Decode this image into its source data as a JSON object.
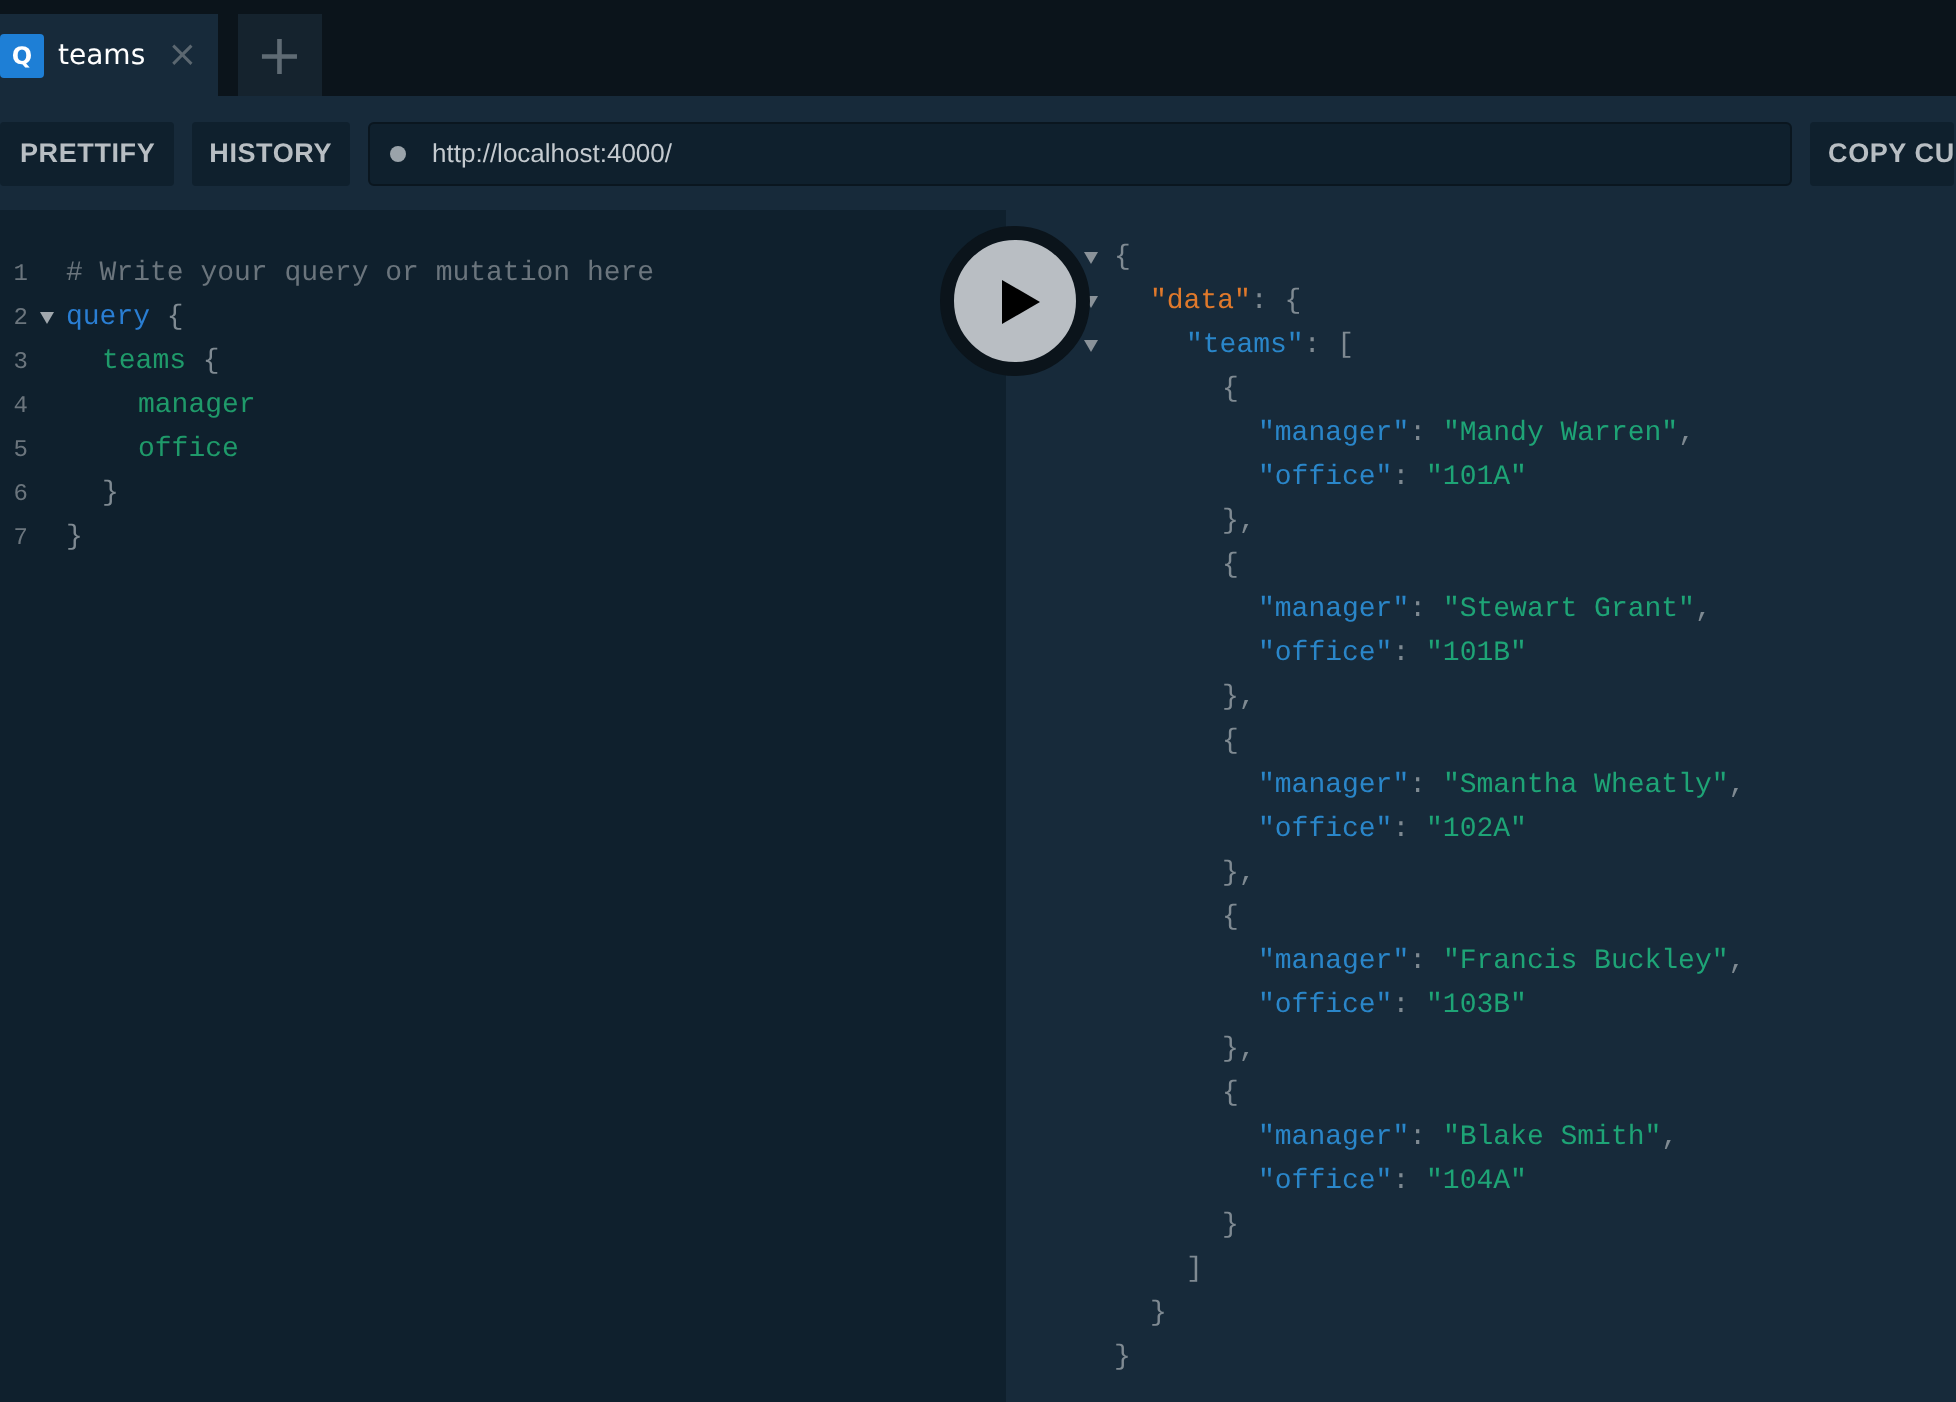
{
  "tabs": [
    {
      "badge": "Q",
      "label": "teams",
      "close": "×",
      "selected": true
    }
  ],
  "new_tab": "+",
  "toolbar": {
    "buttons": [
      "PRETTIFY",
      "HISTORY"
    ],
    "url": "http://localhost:4000/",
    "copy_button": "COPY CU"
  },
  "editor": {
    "lines": [
      {
        "number": "1",
        "tokens": [
          {
            "text": "# Write your query or mutation here",
            "kind": "comment"
          }
        ]
      },
      {
        "number": "2",
        "foldable": true,
        "tokens": [
          {
            "text": "query",
            "kind": "keyword"
          },
          {
            "text": " {",
            "kind": "punct"
          }
        ],
        "children": [
          {
            "number": "3",
            "tokens": [
              {
                "text": "teams",
                "kind": "field"
              },
              {
                "text": " {",
                "kind": "punct"
              }
            ],
            "children": [
              {
                "number": "4",
                "tokens": [
                  {
                    "text": "manager",
                    "kind": "field"
                  }
                ]
              },
              {
                "number": "5",
                "tokens": [
                  {
                    "text": "office",
                    "kind": "field"
                  }
                ]
              }
            ]
          },
          {
            "number": "6",
            "tokens": [
              {
                "text": "}",
                "kind": "punct"
              }
            ]
          }
        ]
      },
      {
        "number": "7",
        "tokens": [
          {
            "text": "}",
            "kind": "punct"
          }
        ]
      }
    ]
  },
  "result": {
    "lines": [
      {
        "foldable": true,
        "tokens": [
          {
            "text": "{",
            "kind": "punct"
          }
        ],
        "children": [
          {
            "foldable": true,
            "tokens": [
              {
                "text": "\"data\"",
                "kind": "root_key"
              },
              {
                "text": ": {",
                "kind": "punct"
              }
            ],
            "children": [
              {
                "foldable": true,
                "tokens": [
                  {
                    "text": "\"teams\"",
                    "kind": "key"
                  },
                  {
                    "text": ": [",
                    "kind": "punct"
                  }
                ],
                "children": [
                  {
                    "tokens": [
                      {
                        "text": "{",
                        "kind": "punct"
                      }
                    ],
                    "children": [
                      {
                        "tokens": [
                          {
                            "text": "\"manager\"",
                            "kind": "key"
                          },
                          {
                            "text": ": ",
                            "kind": "punct"
                          },
                          {
                            "text": "\"Mandy Warren\"",
                            "kind": "string"
                          },
                          {
                            "text": ",",
                            "kind": "punct"
                          }
                        ]
                      },
                      {
                        "tokens": [
                          {
                            "text": "\"office\"",
                            "kind": "key"
                          },
                          {
                            "text": ": ",
                            "kind": "punct"
                          },
                          {
                            "text": "\"101A\"",
                            "kind": "string"
                          }
                        ]
                      }
                    ]
                  },
                  {
                    "tokens": [
                      {
                        "text": "},",
                        "kind": "punct"
                      }
                    ]
                  },
                  {
                    "tokens": [
                      {
                        "text": "{",
                        "kind": "punct"
                      }
                    ],
                    "children": [
                      {
                        "tokens": [
                          {
                            "text": "\"manager\"",
                            "kind": "key"
                          },
                          {
                            "text": ": ",
                            "kind": "punct"
                          },
                          {
                            "text": "\"Stewart Grant\"",
                            "kind": "string"
                          },
                          {
                            "text": ",",
                            "kind": "punct"
                          }
                        ]
                      },
                      {
                        "tokens": [
                          {
                            "text": "\"office\"",
                            "kind": "key"
                          },
                          {
                            "text": ": ",
                            "kind": "punct"
                          },
                          {
                            "text": "\"101B\"",
                            "kind": "string"
                          }
                        ]
                      }
                    ]
                  },
                  {
                    "tokens": [
                      {
                        "text": "},",
                        "kind": "punct"
                      }
                    ]
                  },
                  {
                    "tokens": [
                      {
                        "text": "{",
                        "kind": "punct"
                      }
                    ],
                    "children": [
                      {
                        "tokens": [
                          {
                            "text": "\"manager\"",
                            "kind": "key"
                          },
                          {
                            "text": ": ",
                            "kind": "punct"
                          },
                          {
                            "text": "\"Smantha Wheatly\"",
                            "kind": "string"
                          },
                          {
                            "text": ",",
                            "kind": "punct"
                          }
                        ]
                      },
                      {
                        "tokens": [
                          {
                            "text": "\"office\"",
                            "kind": "key"
                          },
                          {
                            "text": ": ",
                            "kind": "punct"
                          },
                          {
                            "text": "\"102A\"",
                            "kind": "string"
                          }
                        ]
                      }
                    ]
                  },
                  {
                    "tokens": [
                      {
                        "text": "},",
                        "kind": "punct"
                      }
                    ]
                  },
                  {
                    "tokens": [
                      {
                        "text": "{",
                        "kind": "punct"
                      }
                    ],
                    "children": [
                      {
                        "tokens": [
                          {
                            "text": "\"manager\"",
                            "kind": "key"
                          },
                          {
                            "text": ": ",
                            "kind": "punct"
                          },
                          {
                            "text": "\"Francis Buckley\"",
                            "kind": "string"
                          },
                          {
                            "text": ",",
                            "kind": "punct"
                          }
                        ]
                      },
                      {
                        "tokens": [
                          {
                            "text": "\"office\"",
                            "kind": "key"
                          },
                          {
                            "text": ": ",
                            "kind": "punct"
                          },
                          {
                            "text": "\"103B\"",
                            "kind": "string"
                          }
                        ]
                      }
                    ]
                  },
                  {
                    "tokens": [
                      {
                        "text": "},",
                        "kind": "punct"
                      }
                    ]
                  },
                  {
                    "tokens": [
                      {
                        "text": "{",
                        "kind": "punct"
                      }
                    ],
                    "children": [
                      {
                        "tokens": [
                          {
                            "text": "\"manager\"",
                            "kind": "key"
                          },
                          {
                            "text": ": ",
                            "kind": "punct"
                          },
                          {
                            "text": "\"Blake Smith\"",
                            "kind": "string"
                          },
                          {
                            "text": ",",
                            "kind": "punct"
                          }
                        ]
                      },
                      {
                        "tokens": [
                          {
                            "text": "\"office\"",
                            "kind": "key"
                          },
                          {
                            "text": ": ",
                            "kind": "punct"
                          },
                          {
                            "text": "\"104A\"",
                            "kind": "string"
                          }
                        ]
                      }
                    ]
                  },
                  {
                    "tokens": [
                      {
                        "text": "}",
                        "kind": "punct"
                      }
                    ]
                  }
                ]
              },
              {
                "tokens": [
                  {
                    "text": "]",
                    "kind": "punct"
                  }
                ]
              }
            ]
          },
          {
            "tokens": [
              {
                "text": "}",
                "kind": "punct"
              }
            ]
          }
        ]
      },
      {
        "tokens": [
          {
            "text": "}",
            "kind": "punct"
          }
        ]
      }
    ]
  }
}
